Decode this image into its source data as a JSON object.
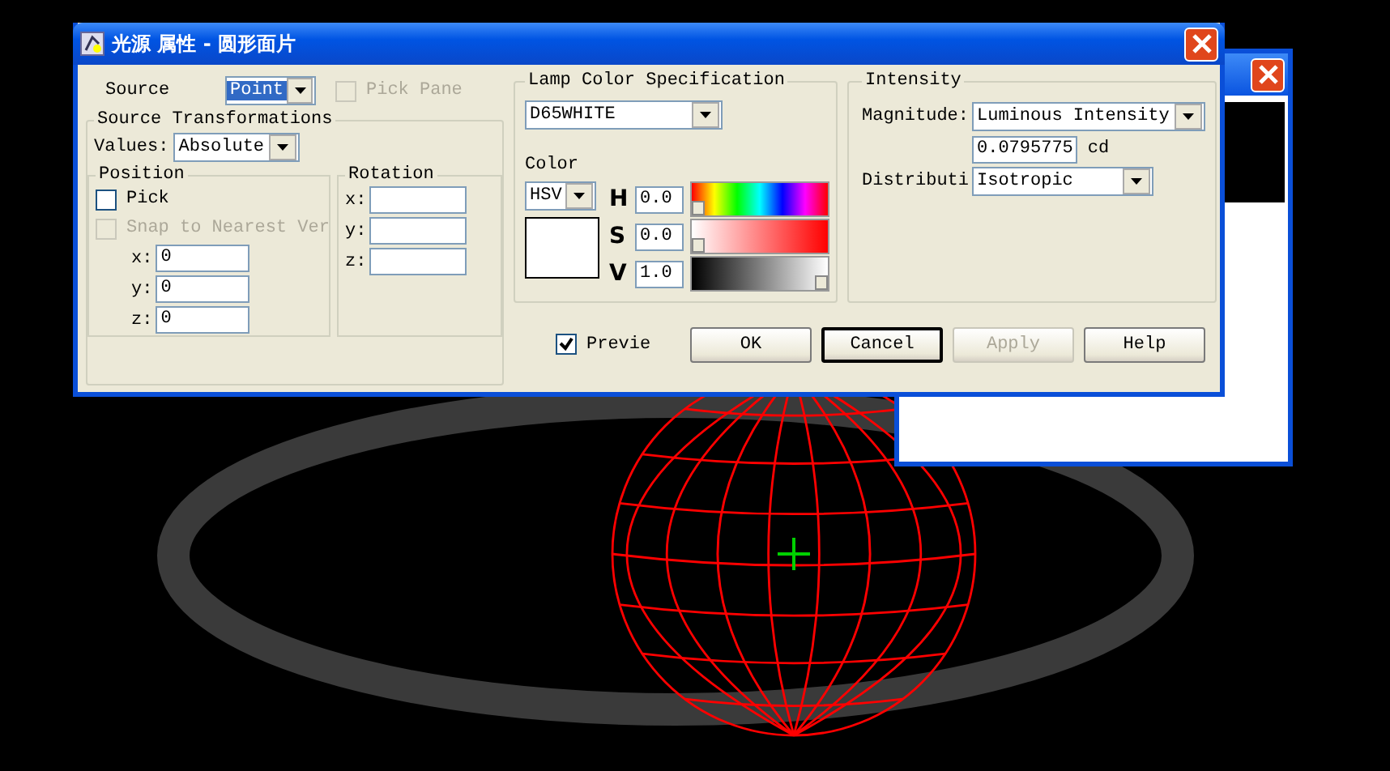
{
  "window": {
    "title": "光源 属性 - 圆形面片"
  },
  "source": {
    "label": "Source",
    "value": "Point",
    "pick_pane": {
      "label": "Pick Pane",
      "checked": false,
      "disabled": true
    }
  },
  "transformations": {
    "title": "Source Transformations",
    "values_label": "Values:",
    "values": "Absolute",
    "position": {
      "title": "Position",
      "pick": {
        "label": "Pick",
        "checked": false,
        "disabled": false
      },
      "snap": {
        "label": "Snap to Nearest Ver",
        "checked": false,
        "disabled": true
      },
      "fields": [
        {
          "label": "x:",
          "value": "0"
        },
        {
          "label": "y:",
          "value": "0"
        },
        {
          "label": "z:",
          "value": "0"
        }
      ]
    },
    "rotation": {
      "title": "Rotation",
      "fields": [
        {
          "label": "x:"
        },
        {
          "label": "y:"
        },
        {
          "label": "z:"
        }
      ]
    }
  },
  "lamp": {
    "title": "Lamp Color Specification",
    "preset": "D65WHITE",
    "color_label": "Color",
    "model": "HSV",
    "channels": [
      {
        "label": "H",
        "value": "0.0",
        "level": 0,
        "kind": "hue"
      },
      {
        "label": "S",
        "value": "0.0",
        "level": 0,
        "kind": "saturation"
      },
      {
        "label": "V",
        "value": "1.0",
        "level": 1,
        "kind": "value"
      }
    ]
  },
  "intensity": {
    "title": "Intensity",
    "magnitude_label": "Magnitude:",
    "magnitude": "Luminous Intensity",
    "value": "0.0795775",
    "unit": "cd",
    "distribution_label": "Distributi",
    "distribution": "Isotropic"
  },
  "preview": {
    "label": "Previe",
    "checked": true
  },
  "buttons": [
    {
      "label": "OK",
      "disabled": false,
      "focused": false
    },
    {
      "label": "Cancel",
      "disabled": false,
      "focused": true
    },
    {
      "label": "Apply",
      "disabled": true,
      "focused": false
    },
    {
      "label": "Help",
      "disabled": false,
      "focused": false
    }
  ]
}
